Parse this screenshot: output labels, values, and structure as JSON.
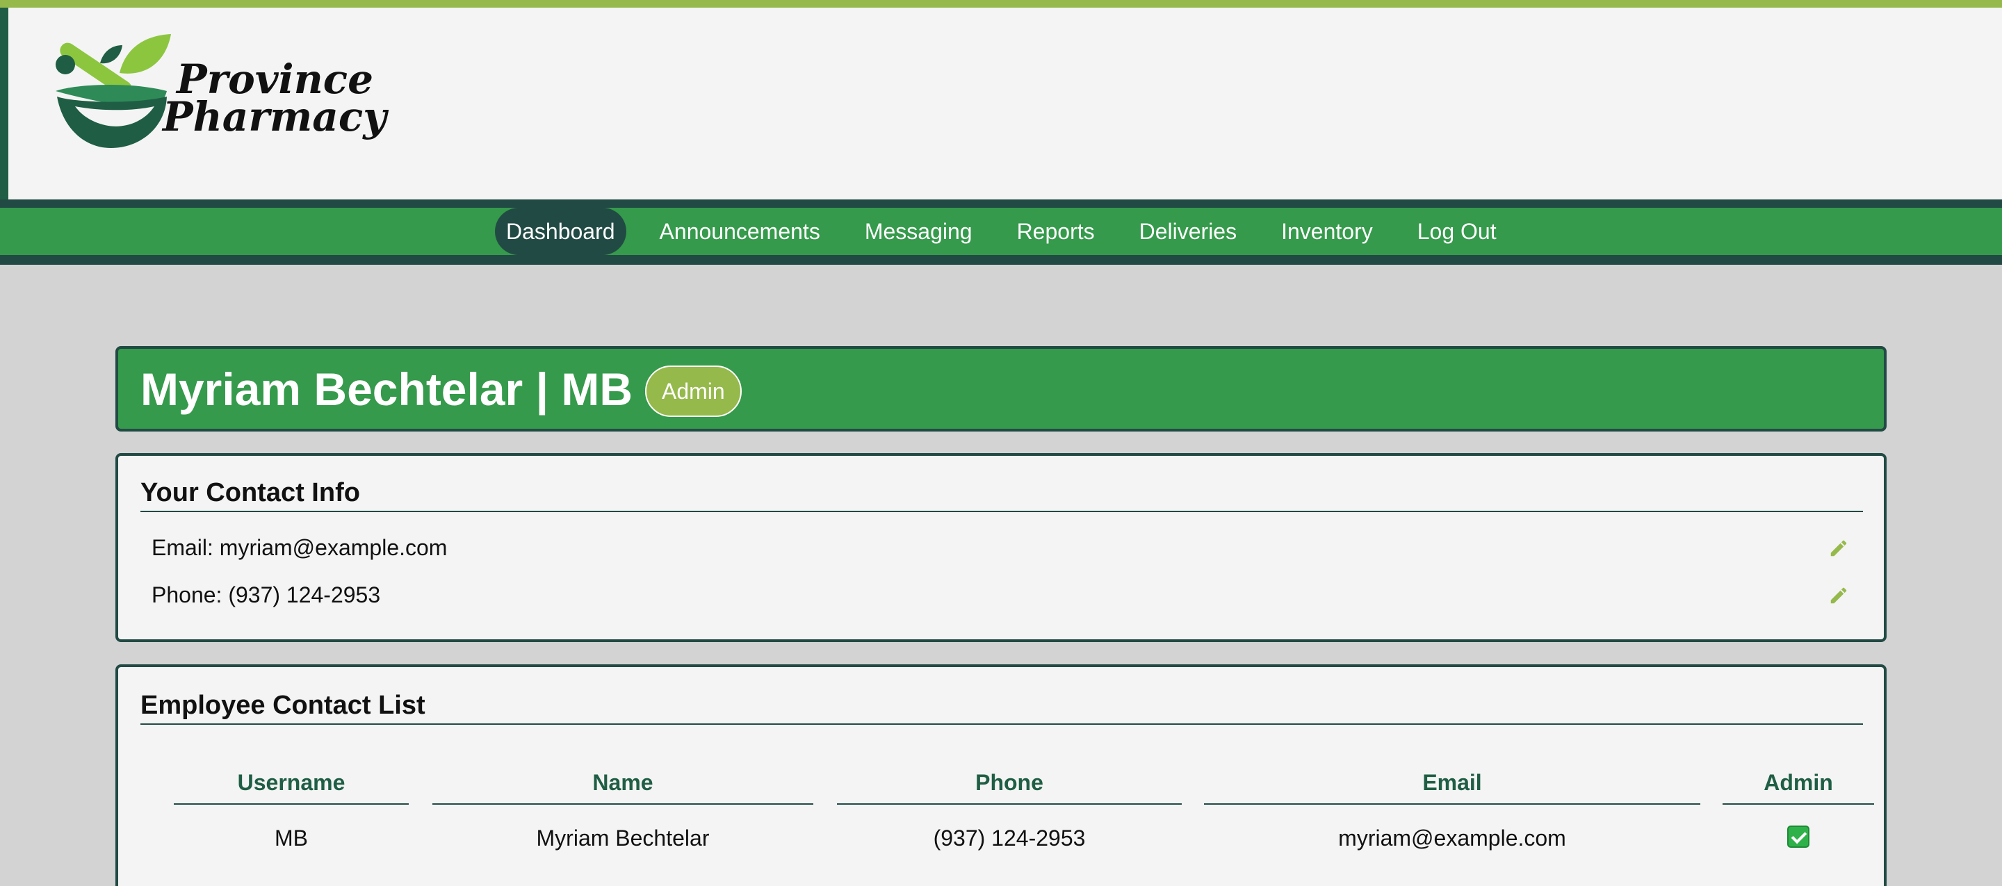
{
  "header": {
    "brand_line1": "Province",
    "brand_line2": "Pharmacy"
  },
  "nav": {
    "items": [
      {
        "label": "Dashboard",
        "active": true
      },
      {
        "label": "Announcements",
        "active": false
      },
      {
        "label": "Messaging",
        "active": false
      },
      {
        "label": "Reports",
        "active": false
      },
      {
        "label": "Deliveries",
        "active": false
      },
      {
        "label": "Inventory",
        "active": false
      },
      {
        "label": "Log Out",
        "active": false
      }
    ]
  },
  "profile": {
    "title": "Myriam Bechtelar | MB",
    "role_badge": "Admin"
  },
  "contact_info": {
    "heading": "Your Contact Info",
    "email_line": "Email: myriam@example.com",
    "phone_line": "Phone: (937) 124-2953"
  },
  "employee_list": {
    "heading": "Employee Contact List",
    "columns": [
      "Username",
      "Name",
      "Phone",
      "Email",
      "Admin"
    ],
    "rows": [
      {
        "username": "MB",
        "name": "Myriam Bechtelar",
        "phone": "(937) 124-2953",
        "email": "myriam@example.com",
        "admin": true
      }
    ]
  },
  "colors": {
    "brand_green": "#359a4b",
    "dark_teal": "#224a44",
    "accent_lime": "#95b94b",
    "background": "#d3d3d3"
  },
  "icons": [
    "logo-mortar-pestle-icon",
    "edit-pencil-icon",
    "checkbox-checked-icon"
  ]
}
